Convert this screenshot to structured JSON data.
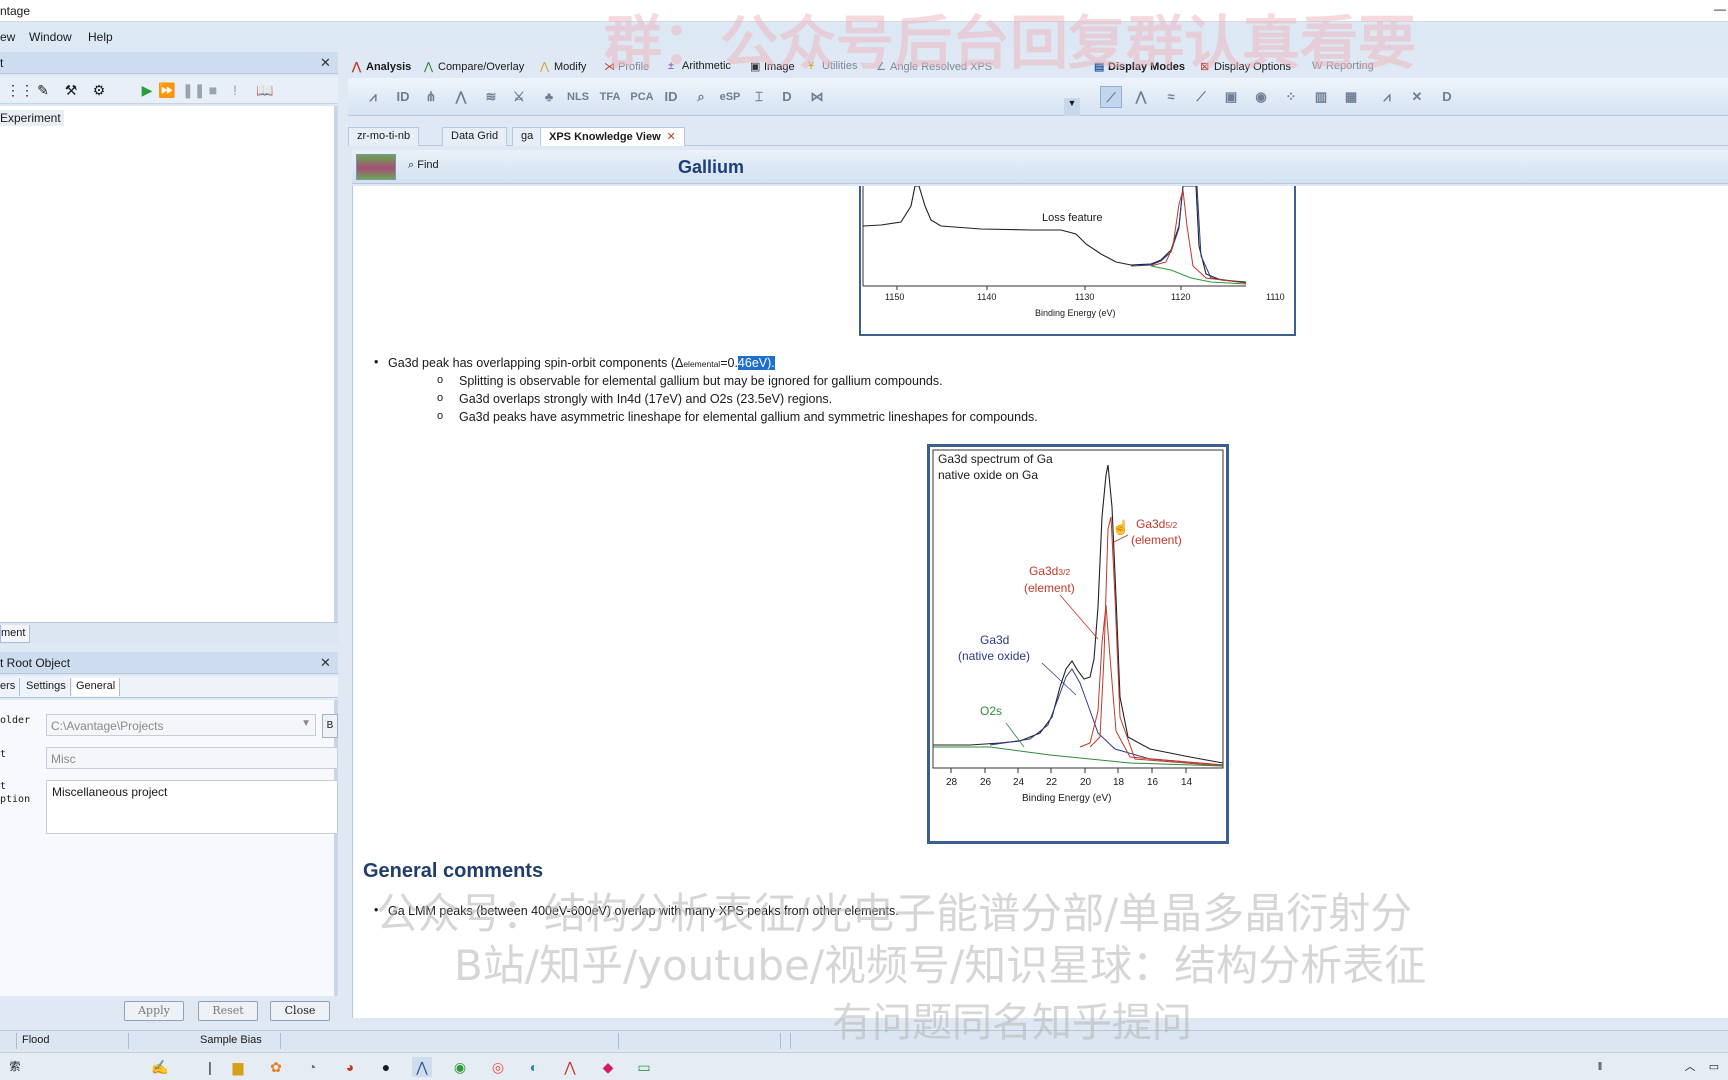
{
  "window": {
    "title": "ntage"
  },
  "menu": [
    "ew",
    "Window",
    "Help"
  ],
  "left_panel": {
    "header": "t",
    "tree_item": "Experiment",
    "bottom_tab": "ment",
    "props_header": "t Root Object",
    "prop_tabs": [
      "ers",
      "Settings",
      "General"
    ],
    "folder_label": "older",
    "folder_value": "C:\\Avantage\\Projects",
    "folder_browse": "B",
    "name_label": "t",
    "name_value": "Misc",
    "desc_label": "t\nption",
    "desc_value": "Miscellaneous project",
    "buttons": {
      "apply": "Apply",
      "reset": "Reset",
      "close": "Close"
    }
  },
  "ribbon": {
    "tabs": [
      "Analysis",
      "Compare/Overlay",
      "Modify",
      "Profile",
      "Arithmetic",
      "Image",
      "Utilities",
      "Angle Resolved XPS"
    ],
    "right_tabs": [
      "Display Modes",
      "Display Options",
      "Reporting"
    ],
    "icon_labels": [
      "ID",
      "NLS",
      "TFA",
      "PCA",
      "ID",
      "eSP"
    ]
  },
  "doc_tabs": [
    "zr-mo-ti-nb",
    "Data Grid",
    "ga",
    "XPS Knowledge View"
  ],
  "toolbar": {
    "find": "Find",
    "element_title": "Gallium"
  },
  "content": {
    "fig1": {
      "annotation": "Loss feature",
      "ticks": [
        "1150",
        "1140",
        "1130",
        "1120",
        "1110"
      ],
      "xlabel": "Binding Energy (eV)"
    },
    "bullet1_pre": "Ga3d peak has overlapping spin-orbit components (Δ",
    "bullet1_sub": "elemental",
    "bullet1_mid": "=0.",
    "bullet1_hl": "46eV).",
    "subs": [
      "Splitting is observable for elemental gallium but may be ignored for gallium compounds.",
      "Ga3d overlaps strongly with In4d (17eV) and O2s (23.5eV) regions.",
      "Ga3d peaks have asymmetric lineshape for elemental gallium and symmetric lineshapes for compounds."
    ],
    "fig2": {
      "title_line1": "Ga3d spectrum of Ga",
      "title_line2": "native oxide on Ga",
      "label_52": "Ga3d",
      "label_52_sub": "5/2",
      "label_52_b": "(element)",
      "label_32": "Ga3d",
      "label_32_sub": "3/2",
      "label_32_b": "(element)",
      "label_ox": "Ga3d",
      "label_ox_b": "(native oxide)",
      "label_o2s": "O2s",
      "ticks": [
        "28",
        "26",
        "24",
        "22",
        "20",
        "18",
        "16",
        "14"
      ],
      "xlabel": "Binding Energy (eV)"
    },
    "general_comments_title": "General comments",
    "general_bullet": "Ga LMM peaks (between 400eV-600eV) overlap with many XPS peaks from other elements."
  },
  "statusbar": {
    "flood": "Flood",
    "sample_bias": "Sample Bias"
  },
  "taskbar": {
    "search_fragment": "索"
  },
  "watermarks": {
    "top": "群：公众号后台回复群认真看要",
    "line1": "公众号：结构分析表征/光电子能谱分部/单晶多晶衍射分",
    "line2": "B站/知乎/youtube/视频号/知识星球：结构分析表征",
    "line3": "有问题同名知乎提问"
  },
  "colors": {
    "accent": "#1c3f7a",
    "highlight": "#1f6fd1",
    "element_label": "#c0392b",
    "oxide_label": "#2b3a8a",
    "o2s_label": "#2e8b3a"
  }
}
